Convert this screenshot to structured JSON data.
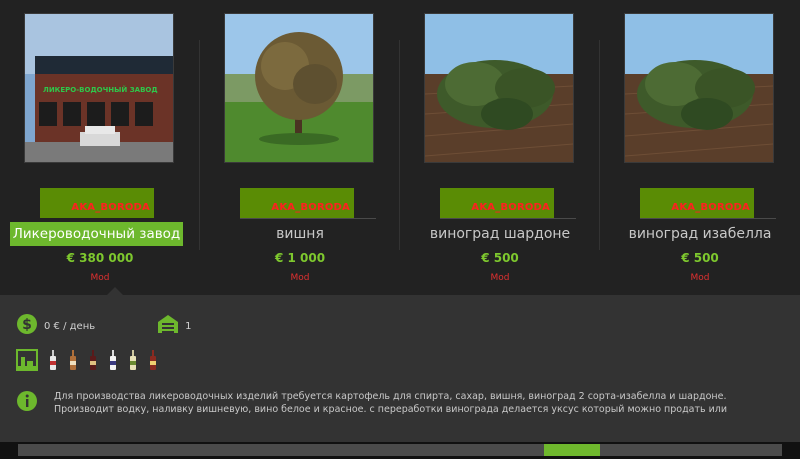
{
  "items": [
    {
      "name": "Ликероводочный завод",
      "price": "€ 380 000",
      "type": "Mod",
      "badge": "AKA_BORODA",
      "sign": "ЛИКЕРО-ВОДОЧНЫЙ ЗАВОД"
    },
    {
      "name": "вишня",
      "price": "€ 1 000",
      "type": "Mod",
      "badge": "AKA_BORODA"
    },
    {
      "name": "виноград шардоне",
      "price": "€ 500",
      "type": "Mod",
      "badge": "AKA_BORODA"
    },
    {
      "name": "виноград изабелла",
      "price": "€ 500",
      "type": "Mod",
      "badge": "AKA_BORODA"
    }
  ],
  "details": {
    "cost_per_day": "0 € / день",
    "capacity": "1",
    "description": "Для производства ликероводочных изделий требуется картофель для спирта, сахар, вишня, виноград 2 сорта-изабелла и шардоне. Производит водку, наливку вишневую, вино белое и красное. с переработки винограда делается уксус который можно продать или"
  },
  "colors": {
    "accent": "#6db82d",
    "price": "#7ec82e",
    "mod": "#e03030",
    "badge": "#5a8c05"
  }
}
